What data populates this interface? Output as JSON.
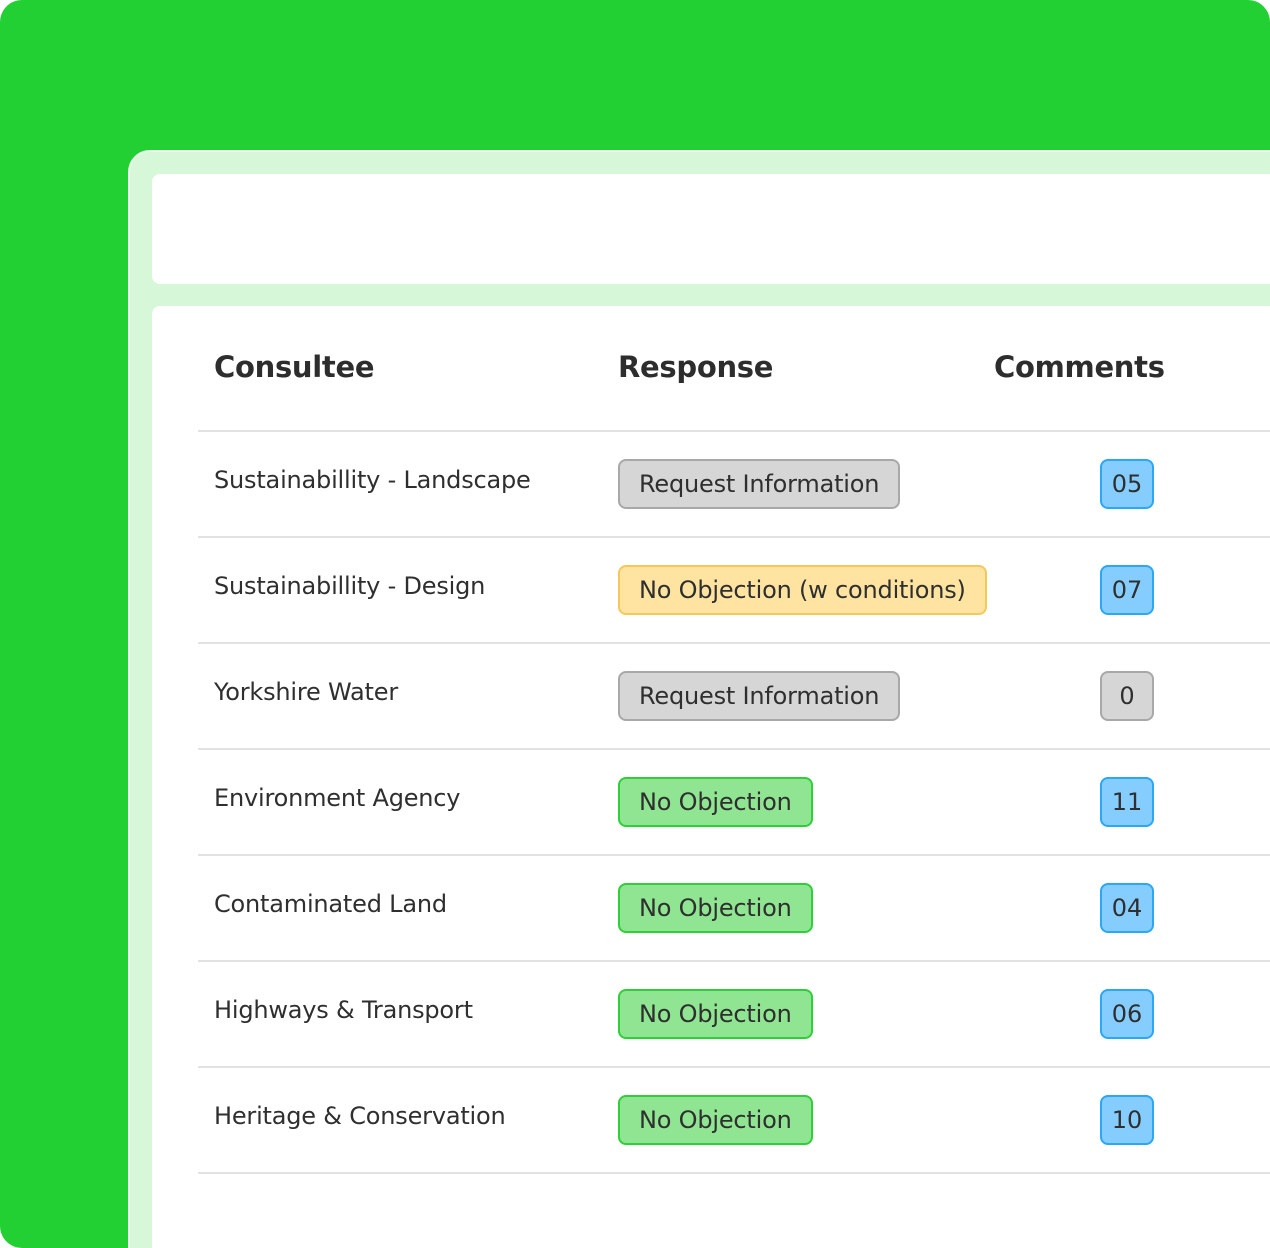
{
  "colors": {
    "backdrop": "#23d033",
    "frame": "#d6f7d8",
    "pill_grey": "#d6d6d6",
    "pill_amber": "#ffe3a0",
    "pill_green": "#8fe591",
    "badge_blue": "#86cdff"
  },
  "table": {
    "headers": {
      "consultee": "Consultee",
      "response": "Response",
      "comments": "Comments"
    },
    "rows": [
      {
        "consultee": "Sustainabillity - Landscape",
        "response": "Request Information",
        "response_status": "grey",
        "comments": "05",
        "comments_status": "blue"
      },
      {
        "consultee": "Sustainabillity - Design",
        "response": "No Objection (w conditions)",
        "response_status": "amber",
        "comments": "07",
        "comments_status": "blue"
      },
      {
        "consultee": "Yorkshire Water",
        "response": "Request Information",
        "response_status": "grey",
        "comments": "0",
        "comments_status": "grey"
      },
      {
        "consultee": "Environment Agency",
        "response": "No Objection",
        "response_status": "green",
        "comments": "11",
        "comments_status": "blue"
      },
      {
        "consultee": "Contaminated Land",
        "response": "No Objection",
        "response_status": "green",
        "comments": "04",
        "comments_status": "blue"
      },
      {
        "consultee": "Highways & Transport",
        "response": "No Objection",
        "response_status": "green",
        "comments": "06",
        "comments_status": "blue"
      },
      {
        "consultee": "Heritage & Conservation",
        "response": "No Objection",
        "response_status": "green",
        "comments": "10",
        "comments_status": "blue"
      }
    ]
  }
}
